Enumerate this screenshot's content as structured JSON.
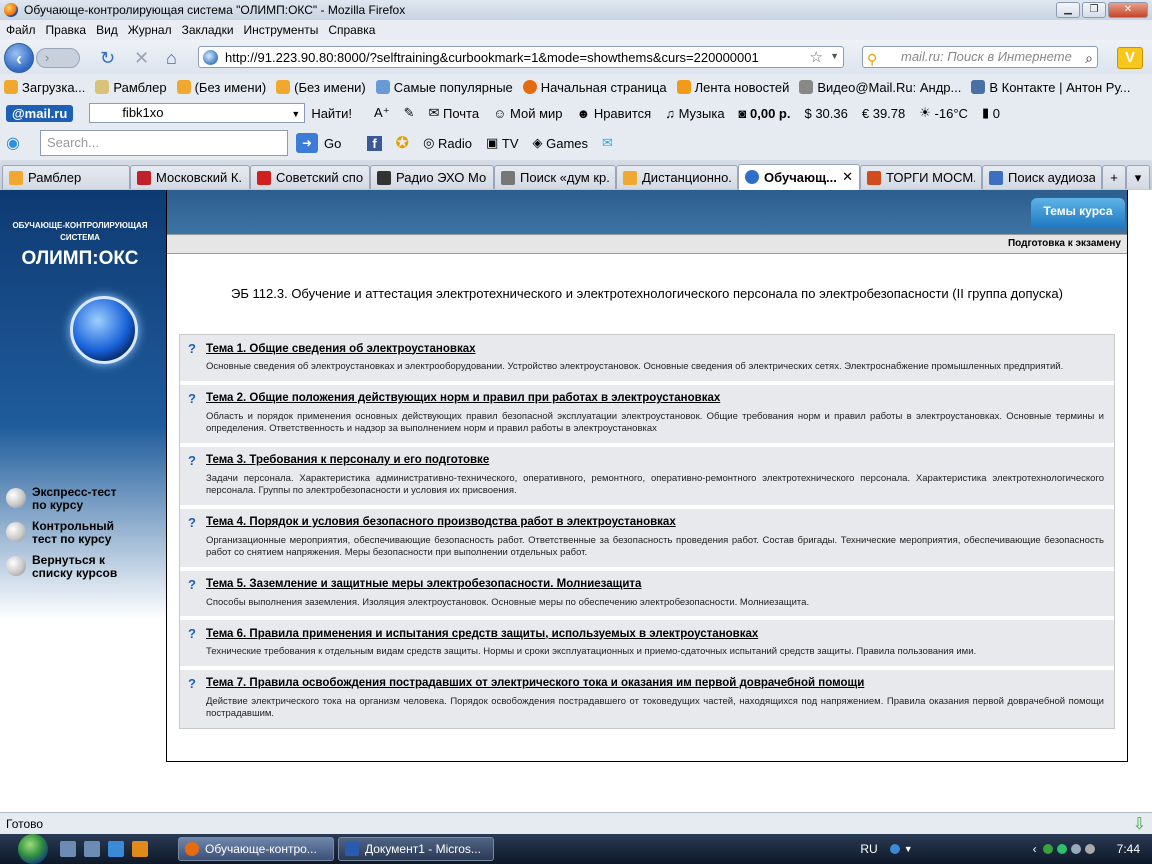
{
  "window": {
    "title": "Обучающе-контролирующая система \"ОЛИМП:ОКС\" - Mozilla Firefox",
    "min": "▁",
    "max": "❐",
    "close": "✕"
  },
  "menu": [
    "Файл",
    "Правка",
    "Вид",
    "Журнал",
    "Закладки",
    "Инструменты",
    "Справка"
  ],
  "nav": {
    "back": "‹",
    "forward": "›",
    "reload": "↻",
    "stop": "✕",
    "home": "⌂",
    "url": "http://91.223.90.80:8000/?selftraining&curbookmark=1&mode=showthems&curs=220000001",
    "search_placeholder": "mail.ru: Поиск в Интернете",
    "v": "V"
  },
  "bookmarks": [
    "Загрузка...",
    "Рамблер",
    "(Без имени)",
    "(Без имени)",
    "Самые популярные",
    "Начальная страница",
    "Лента новостей",
    "Видео@Mail.Ru: Андр...",
    "В Контакте | Антон Ру..."
  ],
  "mailbar": {
    "logo": "@mail.ru",
    "input": "fibk1xo",
    "find": "Найти!",
    "items": [
      "Почта",
      "Мой мир",
      "Нравится",
      "Музыка",
      "0,00 р.",
      "30.36",
      "39.78",
      "-16°C",
      "0"
    ]
  },
  "skypebar": {
    "placeholder": "Search...",
    "go": "Go",
    "radio": "Radio",
    "tv": "TV",
    "games": "Games"
  },
  "tabs": [
    {
      "label": "Рамблер",
      "active": false,
      "color": "#f0a830"
    },
    {
      "label": "Московский К...",
      "active": false,
      "color": "#c2202a"
    },
    {
      "label": "Советский спо...",
      "active": false,
      "color": "#d21f1f"
    },
    {
      "label": "Радио ЭХО Мо...",
      "active": false,
      "color": "#333333"
    },
    {
      "label": "Поиск «дум кр...",
      "active": false,
      "color": "#777777"
    },
    {
      "label": "Дистанционно...",
      "active": false,
      "color": "#f0a830"
    },
    {
      "label": "Обучающ...",
      "active": true,
      "color": "#2f6fc8"
    },
    {
      "label": "ТОРГИ МОСМ...",
      "active": false,
      "color": "#d24b1f"
    },
    {
      "label": "Поиск аудиоза...",
      "active": false,
      "color": "#3c6fc2"
    }
  ],
  "site": {
    "banner_subtitle": "ОБУЧАЮЩЕ-КОНТРОЛИРУЮЩАЯ СИСТЕМА",
    "banner_logo": "ОЛИМП:ОКС",
    "themes_tab": "Темы курса",
    "breadcrumb": "Подготовка к экзамену",
    "course_title": "ЭБ 112.3. Обучение и аттестация электротехнического и электротехнологического персонала по электробезопасности (II группа допуска)",
    "left_menu": [
      "Экспресс-тест по курсу",
      "Контрольный тест по курсу",
      "Вернуться к списку курсов"
    ]
  },
  "topics": [
    {
      "title": "Тема 1. Общие сведения об электроустановках",
      "desc": "Основные сведения об электроустановках и электрооборудовании. Устройство электроустановок. Основные сведения об электрических сетях. Электроснабжение промышленных предприятий."
    },
    {
      "title": "Тема 2. Общие положения действующих норм и правил при работах в электроустановках",
      "desc": "Область и порядок применения основных действующих правил безопасной эксплуатации электроустановок. Общие требования норм и правил работы в электроустановках. Основные термины и определения. Ответственность и надзор за выполнением норм и правил работы в электроустановках"
    },
    {
      "title": "Тема 3. Требования к персоналу и его подготовке",
      "desc": "Задачи персонала. Характеристика административно-технического, оперативного, ремонтного, оперативно-ремонтного электротехнического персонала. Характеристика электротехнологического персонала. Группы по электробезопасности и условия их присвоения."
    },
    {
      "title": "Тема 4. Порядок и условия безопасного производства работ в электроустановках",
      "desc": "Организационные мероприятия, обеспечивающие безопасность работ. Ответственные за безопасность проведения работ. Состав бригады. Технические мероприятия, обеспечивающие безопасность работ со снятием напряжения. Меры безопасности при выполнении отдельных работ."
    },
    {
      "title": "Тема 5. Заземление и защитные меры электробезопасности. Молниезащита",
      "desc": "Способы выполнения заземления. Изоляция электроустановок. Основные меры по обеспечению электробезопасности. Молниезащита."
    },
    {
      "title": "Тема 6. Правила применения и испытания средств защиты, используемых в электроустановках",
      "desc": "Технические требования к отдельным видам средств защиты. Нормы и сроки эксплуатационных и приемо-сдаточных испытаний средств защиты. Правила пользования ими."
    },
    {
      "title": "Тема 7. Правила освобождения пострадавших от электрического тока и оказания им первой доврачебной помощи",
      "desc": "Действие электрического тока на организм человека. Порядок освобождения пострадавшего от токоведущих частей, находящихся под напряжением. Правила оказания первой доврачебной помощи пострадавшим."
    }
  ],
  "topic_marker": "?",
  "status": "Готово",
  "taskbar": {
    "items": [
      "Обучающе-контро...",
      "Документ1 - Micros..."
    ],
    "lang": "RU",
    "clock": "7:44"
  }
}
